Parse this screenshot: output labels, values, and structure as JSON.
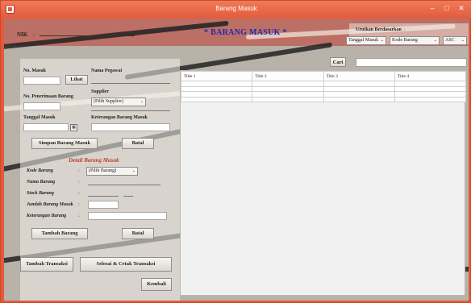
{
  "window": {
    "title": "Barang Masuk"
  },
  "titlebar_buttons": {
    "minimize": "–",
    "maximize": "□",
    "close": "✕"
  },
  "header": {
    "nik_label": "NIK",
    "colon": ":",
    "page_title": "* BARANG MASUK *",
    "sort_label": "Urutkan Berdasarkan",
    "sort_field": "Tanggal Masuk",
    "sort_field_2": "Kode Barang",
    "sort_order": "ASC"
  },
  "form": {
    "no_masuk_label": "No. Masuk",
    "lihat_button": "Lihat",
    "nama_pegawai_label": "Nama Pegawai",
    "supplier_label": "Supplier",
    "supplier_value": "(Pilih Supplier)",
    "no_penerimaan_label": "No. Penerimaan Barang",
    "tanggal_masuk_label": "Tanggal Masuk",
    "keterangan_label": "Keterangan Barang Masuk",
    "simpan_button": "Simpan Barang Masuk",
    "batal_button": "Batal"
  },
  "detail": {
    "title": "Detail Barang Masuk",
    "kode_label": "Kode Barang",
    "kode_value": "(Pilih Barang)",
    "nama_label": "Nama Barang",
    "stock_label": "Stock Barang",
    "jumlah_label": "Jumlah Barang Masuk",
    "keterangan_label": "Keterangan Barang",
    "colon": ":",
    "tambah_button": "Tambah Barang",
    "batal_button": "Batal"
  },
  "actions": {
    "tambah_transaksi": "Tambah Transaksi",
    "selesai_cetak": "Selesai & Cetak Transaksi",
    "kembali": "Kembali"
  },
  "search": {
    "button": "Cari"
  },
  "table": {
    "columns": [
      "Title 1",
      "Title 2",
      "Title 3",
      "Title 4"
    ]
  },
  "colors": {
    "titlebar": "#e35d3d",
    "title_blue": "#1a2ab8",
    "detail_red": "#c0392b"
  }
}
